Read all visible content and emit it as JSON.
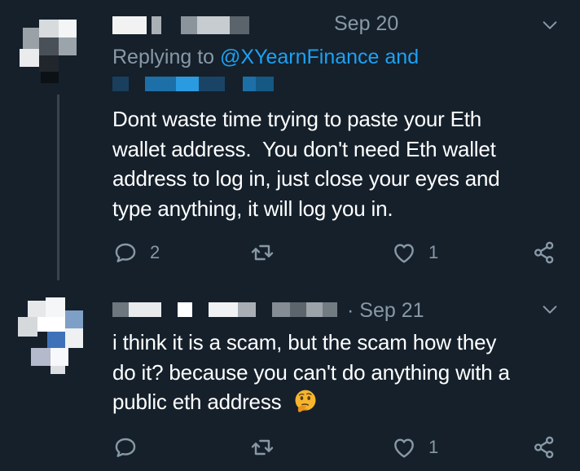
{
  "tweets": [
    {
      "date": "Sep 20",
      "replying_prefix": "Replying to ",
      "replying_handle": "@XYearnFinance and",
      "text_lines": [
        "Dont waste time trying to paste your Eth",
        "wallet address.  You don't need Eth wallet",
        "address to log in, just close your eyes and",
        "type anything, it will log you in."
      ],
      "actions": {
        "reply_count": "2",
        "retweet_count": "",
        "like_count": "1"
      }
    },
    {
      "date": "· Sep 21",
      "text_lines": [
        "i think it is a scam, but the scam how they",
        "do it? because you can't do anything with a",
        "public eth address"
      ],
      "emoji": "thinking-face",
      "actions": {
        "reply_count": "",
        "retweet_count": "",
        "like_count": "1"
      }
    }
  ],
  "colors": {
    "background": "#15202b",
    "muted": "#8899a6",
    "link": "#1da1f2",
    "text": "#ffffff",
    "divider": "#38444d"
  },
  "icons": [
    "chevron-down-icon",
    "reply-icon",
    "retweet-icon",
    "like-icon",
    "share-icon"
  ]
}
